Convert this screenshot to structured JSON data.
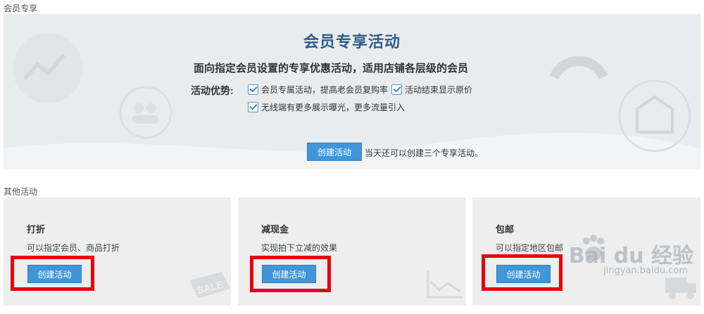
{
  "sections": {
    "member_title": "会员专享",
    "other_title": "其他活动"
  },
  "banner": {
    "title": "会员专享活动",
    "subtitle": "面向指定会员设置的专享优惠活动，适用店铺各层级的会员",
    "advantages_label": "活动优势:",
    "advantages": [
      "会员专属活动，提高老会员复购率",
      "活动结束显示原价",
      "无线端有更多展示曝光，更多流量引入"
    ],
    "button_label": "创建活动",
    "note": "当天还可以创建三个专享活动。"
  },
  "cards": [
    {
      "title": "打折",
      "description": "可以指定会员、商品打折",
      "button_label": "创建活动",
      "decor_text": "SALE"
    },
    {
      "title": "减现金",
      "description": "实现拍下立减的效果",
      "button_label": "创建活动"
    },
    {
      "title": "包邮",
      "description": "可以指定地区包邮",
      "button_label": "创建活动"
    }
  ],
  "watermark": {
    "brand": "Bai du 经验",
    "url": "jingyan.baidu.com"
  },
  "colors": {
    "accent": "#3f96d8",
    "title_blue": "#2f5d8c",
    "highlight_red": "#e8000b",
    "banner_bg": "#e9ecef",
    "card_bg": "#eeeeee"
  }
}
